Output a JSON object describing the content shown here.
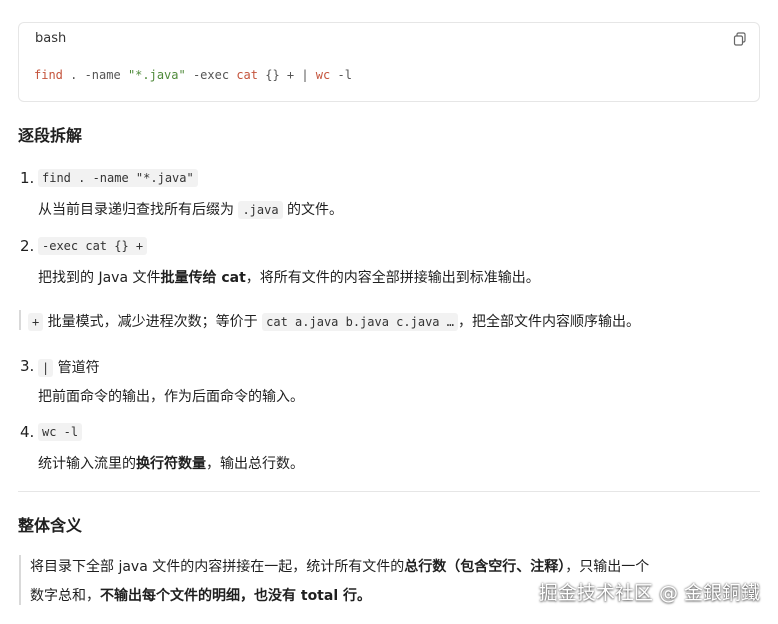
{
  "code_block": {
    "language": "bash",
    "tokens": {
      "t1": "find",
      "t2": " . -name ",
      "t3": "\"*.java\"",
      "t4": " -exec ",
      "t5": "cat",
      "t6": " {} + | ",
      "t7": "wc",
      "t8": " -l"
    }
  },
  "section1": {
    "title": "逐段拆解",
    "items": [
      {
        "number": "1.",
        "code": "find . -name \"*.java\"",
        "desc_prefix": "从当前目录递归查找所有后缀为 ",
        "desc_code": ".java",
        "desc_suffix": " 的文件。"
      },
      {
        "number": "2.",
        "code": "-exec cat {} +",
        "desc_prefix": "把找到的 Java 文件",
        "desc_bold": "批量传给 cat",
        "desc_suffix": "，将所有文件的内容全部拼接输出到标准输出。"
      },
      {
        "number": "3.",
        "code": "|",
        "code_suffix": " 管道符",
        "desc": "把前面命令的输出，作为后面命令的输入。"
      },
      {
        "number": "4.",
        "code": "wc -l",
        "desc_prefix": "统计输入流里的",
        "desc_bold": "换行符数量",
        "desc_suffix": "，输出总行数。"
      }
    ],
    "note": {
      "code1": "+",
      "text1": " 批量模式，减少进程次数；等价于 ",
      "code2": "cat a.java b.java c.java …",
      "text2": "，把全部文件内容顺序输出。"
    }
  },
  "section2": {
    "title": "整体含义",
    "line1_prefix": "将目录下全部 java 文件的内容拼接在一起，统计所有文件的",
    "line1_bold": "总行数（包含空行、注释）",
    "line1_suffix": "，只输出一个",
    "line2_prefix": "数字总和，",
    "line2_bold": "不输出每个文件的明细，也没有 total 行。"
  },
  "watermark": "掘金技术社区 @ 金銀銅鐵",
  "colors": {
    "command": "#c4533b",
    "string": "#4f8a3a",
    "inline_code_bg": "#f2f2f2"
  },
  "icons": {
    "copy": "copy-icon"
  }
}
